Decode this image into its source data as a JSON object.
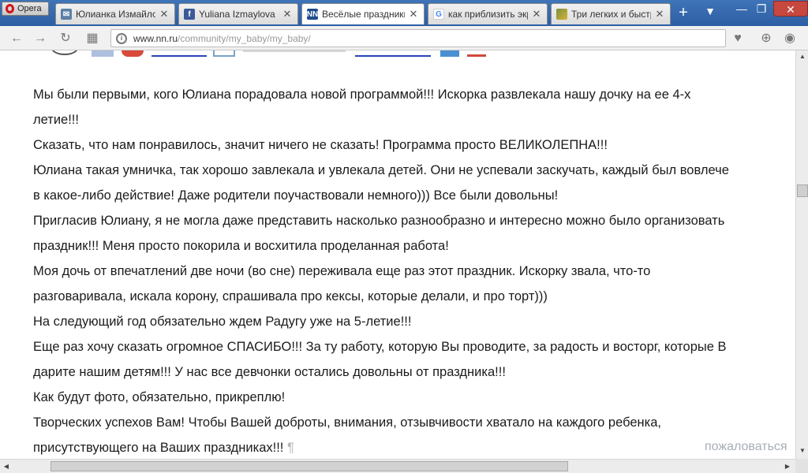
{
  "browser": {
    "menu_label": "Opera",
    "tabs": [
      {
        "label": "Юлианка Измайлова",
        "favicon": "vk-icon",
        "active": false
      },
      {
        "label": "Yuliana Izmaylova",
        "favicon": "facebook-icon",
        "active": false
      },
      {
        "label": "Весёлые праздники",
        "favicon": "nn-icon",
        "favicon_text": "NN",
        "active": true
      },
      {
        "label": "как приблизить экр",
        "favicon": "google-icon",
        "favicon_text": "G",
        "active": false
      },
      {
        "label": "Три легких и быстр",
        "favicon": "image-icon",
        "active": false
      }
    ],
    "new_tab_symbol": "+",
    "tab_menu_symbol": "▼",
    "window_buttons": {
      "minimize": "—",
      "restore": "❐",
      "close": "✕"
    },
    "address": {
      "host": "www.nn.ru",
      "path": "/community/my_baby/my_baby/"
    }
  },
  "post": {
    "paragraphs": [
      "Мы были первыми, кого Юлиана порадовала новой программой!!! Искорка развлекала нашу дочку на ее 4-х",
      "летие!!!",
      "Сказать, что нам понравилось, значит ничего не сказать! Программа просто ВЕЛИКОЛЕПНА!!!",
      "Юлиана такая умничка, так хорошо завлекала и увлекала детей. Они не успевали заскучать, каждый был вовлече",
      "в какое-либо действие! Даже родители поучаствовали немного))) Все были довольны!",
      "Пригласив Юлиану, я не могла даже представить насколько разнообразно и интересно можно было организовать",
      "праздник!!! Меня просто покорила и восхитила проделанная работа!",
      "Моя дочь от впечатлений две ночи (во сне) переживала еще раз этот праздник. Искорку звала, что-то",
      "разговаривала, искала корону, спрашивала про кексы, которые делали, и про торт)))",
      "На следующий год обязательно ждем Радугу уже на 5-летие!!!",
      "Еще раз хочу сказать огромное СПАСИБО!!! За ту работу, которую Вы проводите, за радость и восторг, которые В",
      "дарите нашим детям!!! У нас все девчонки остались довольны от праздника!!!",
      "Как будут фото, обязательно, прикреплю!",
      "Творческих успехов Вам! Чтобы Вашей доброты, внимания, отзывчивости хватало на каждого ребенка,",
      "присутствующего на Ваших праздниках!!!"
    ],
    "pilcrow": "¶",
    "report_link": "пожаловаться"
  },
  "colors": {
    "tabbar": "#2d5ea3",
    "link": "#a7adb8"
  }
}
